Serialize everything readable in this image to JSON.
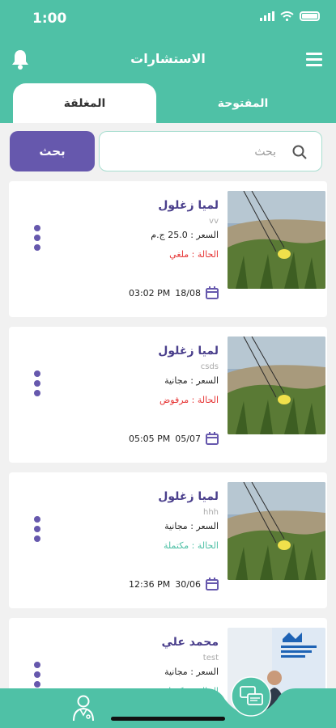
{
  "status_bar": {
    "time": "1:00"
  },
  "header": {
    "title": "الاستشارات"
  },
  "tabs": {
    "open": "المفتوحة",
    "closed": "المغلقة"
  },
  "search": {
    "placeholder": "بحث",
    "button_label": "بحث"
  },
  "colors": {
    "primary": "#4fc1a6",
    "accent": "#6658ad",
    "status_cancelled": "#e63535",
    "status_completed": "#4fc1a6"
  },
  "consultations": [
    {
      "name": "لميا زغلول",
      "subtitle": "vv",
      "price": "السعر : 25.0 ج.م",
      "status": "الحالة : ملغي",
      "status_color": "#e63535",
      "date": "18/08",
      "time": "03:02 PM",
      "image": "flower-photo"
    },
    {
      "name": "لميا زغلول",
      "subtitle": "csds",
      "price": "السعر : مجانية",
      "status": "الحالة : مرفوض",
      "status_color": "#e63535",
      "date": "05/07",
      "time": "05:05 PM",
      "image": "flower-photo"
    },
    {
      "name": "لميا زغلول",
      "subtitle": "hhh",
      "price": "السعر : مجانية",
      "status": "الحالة : مكتملة",
      "status_color": "#4fc1a6",
      "date": "30/06",
      "time": "12:36 PM",
      "image": "flower-photo"
    },
    {
      "name": "محمد علي",
      "subtitle": "test",
      "price": "السعر : مجانية",
      "status": "الحالة : مكتملة",
      "status_color": "#4fc1a6",
      "date": "",
      "time": "",
      "image": "person-photo"
    }
  ],
  "bottom_nav": {
    "items": [
      "doctor-icon",
      "consultations-icon"
    ]
  }
}
